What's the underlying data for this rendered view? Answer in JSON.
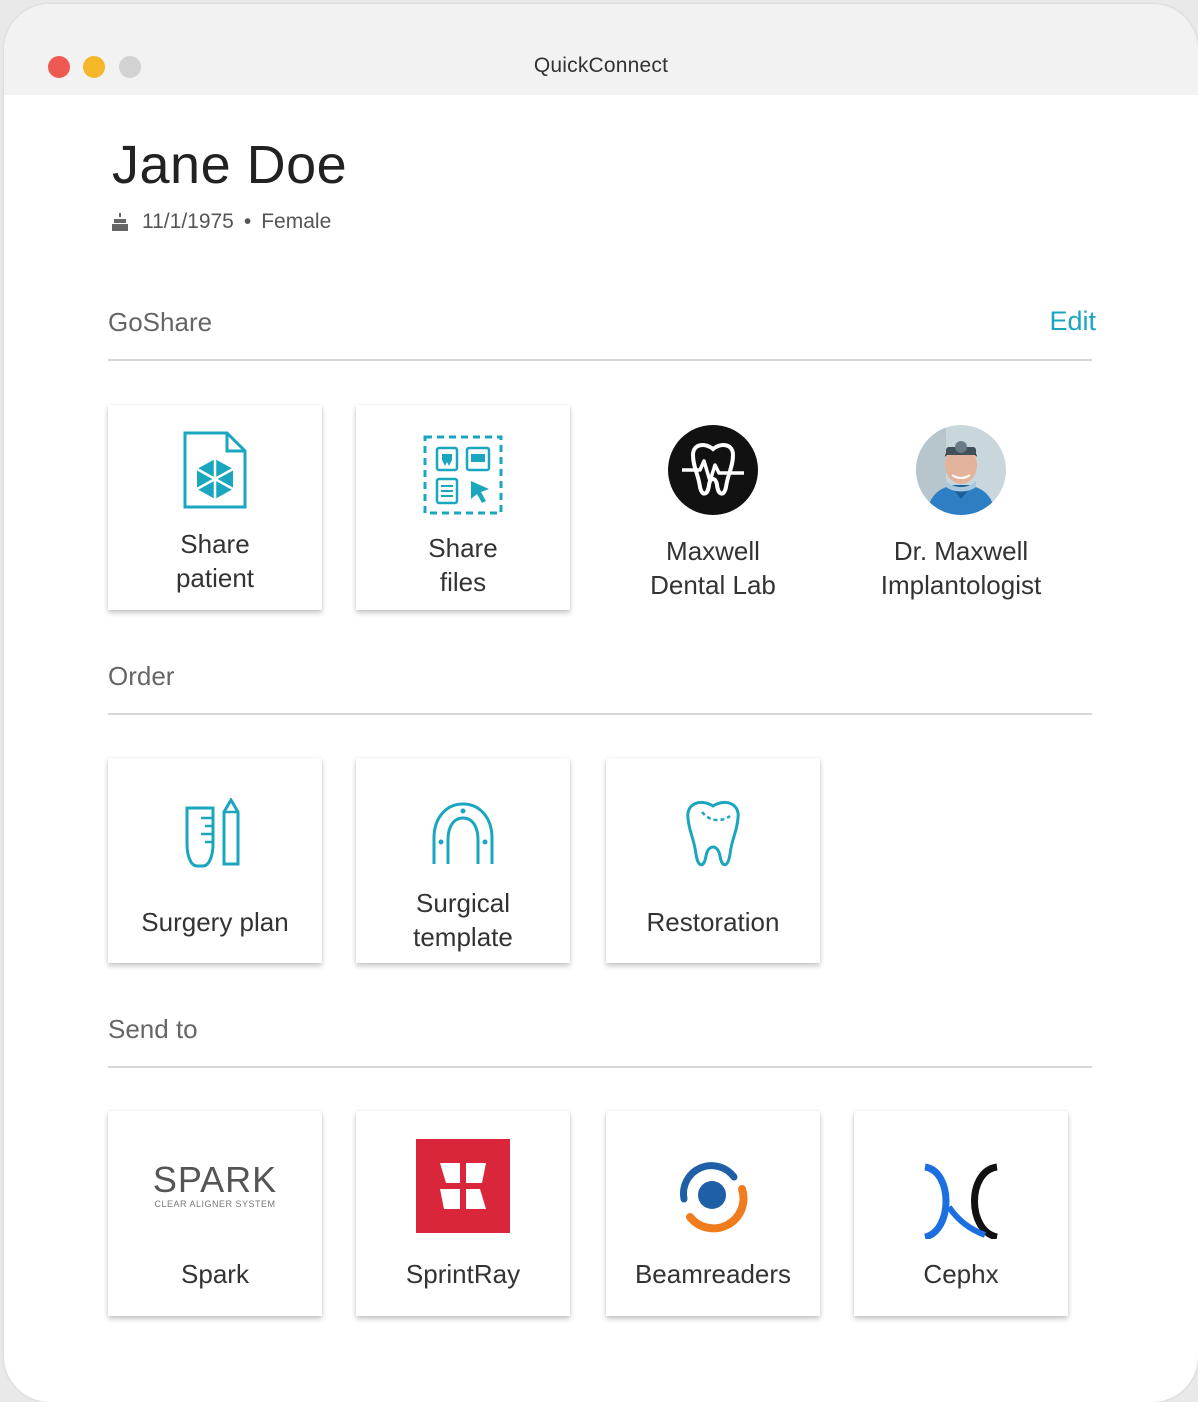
{
  "window": {
    "title": "QuickConnect",
    "controls": {
      "close_color": "#ee5a52",
      "minimize_color": "#f5b627",
      "zoom_color": "#d2d2d2"
    }
  },
  "patient": {
    "name": "Jane Doe",
    "birthdate": "11/1/1975",
    "separator": "•",
    "sex": "Female"
  },
  "accent_color": "#1ba6bf",
  "sections": {
    "goshare": {
      "title": "GoShare",
      "edit_label": "Edit",
      "items": [
        {
          "label": "Share\npatient",
          "icon": "share-patient-icon"
        },
        {
          "label": "Share\nfiles",
          "icon": "share-files-icon"
        },
        {
          "label": "Maxwell\nDental Lab",
          "icon": "dental-lab-logo"
        },
        {
          "label": "Dr. Maxwell\nImplantologist",
          "icon": "doctor-avatar"
        }
      ]
    },
    "order": {
      "title": "Order",
      "items": [
        {
          "label": "Surgery plan",
          "icon": "surgery-plan-icon"
        },
        {
          "label": "Surgical\ntemplate",
          "icon": "surgical-template-icon"
        },
        {
          "label": "Restoration",
          "icon": "tooth-icon"
        }
      ]
    },
    "send_to": {
      "title": "Send to",
      "items": [
        {
          "label": "Spark",
          "icon": "spark-logo",
          "logo_text": "SPARK",
          "logo_subtext": "CLEAR ALIGNER SYSTEM"
        },
        {
          "label": "SprintRay",
          "icon": "sprintray-logo"
        },
        {
          "label": "Beamreaders",
          "icon": "beamreaders-logo"
        },
        {
          "label": "Cephx",
          "icon": "cephx-logo"
        }
      ]
    }
  }
}
